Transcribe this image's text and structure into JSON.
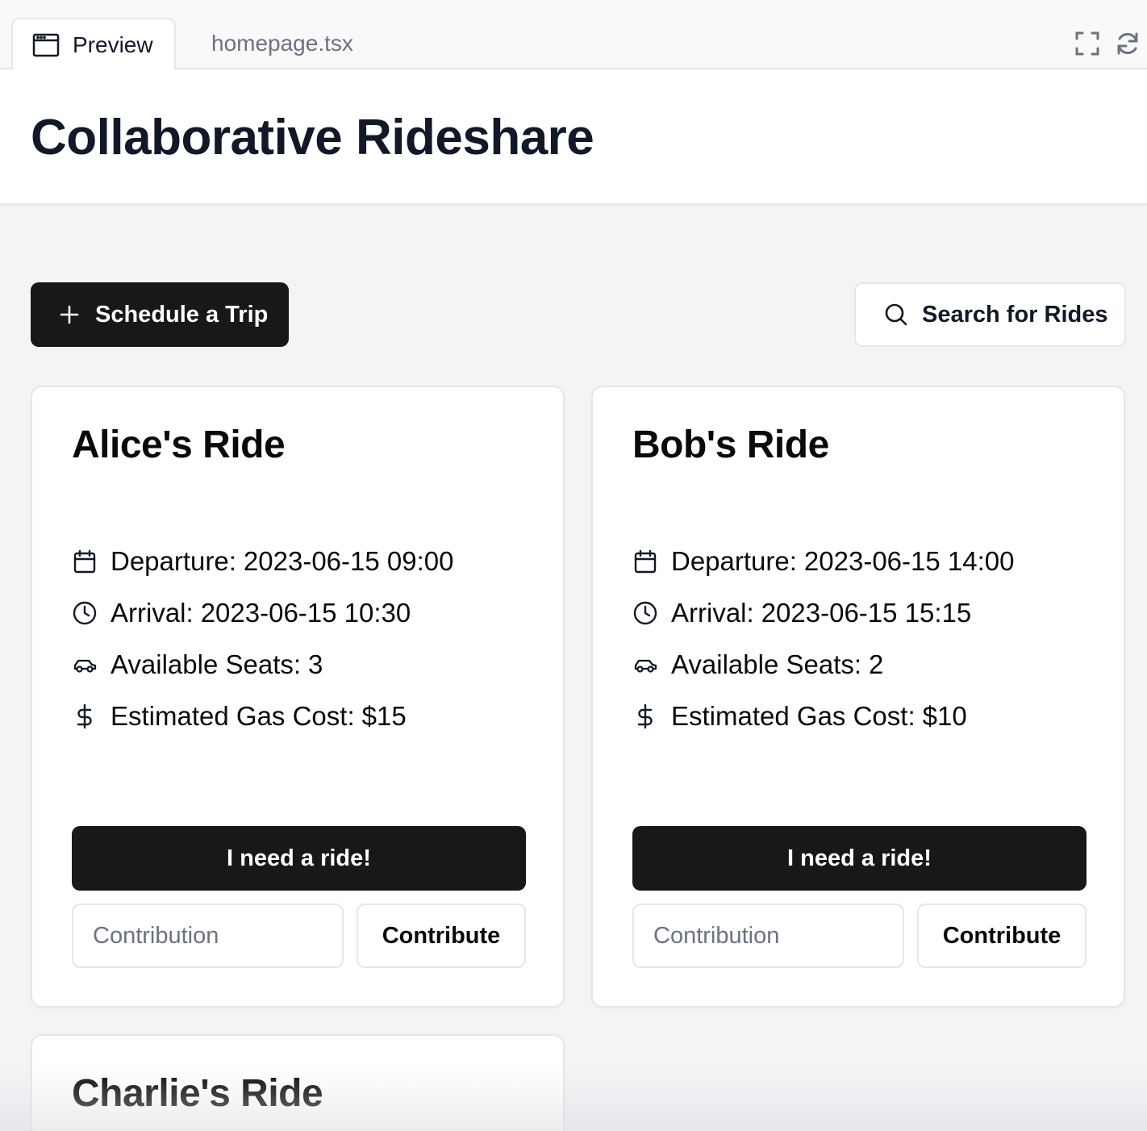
{
  "tabs": {
    "preview_label": "Preview",
    "file_label": "homepage.tsx",
    "icons": [
      "window-icon",
      "fullscreen-icon",
      "refresh-icon"
    ]
  },
  "app": {
    "title": "Collaborative Rideshare"
  },
  "actions": {
    "schedule_label": "Schedule a Trip",
    "search_label": "Search for Rides",
    "schedule_icon": "plus-icon",
    "search_icon": "search-icon"
  },
  "labels": {
    "departure": "Departure:",
    "arrival": "Arrival:",
    "seats": "Available Seats:",
    "gas": "Estimated Gas Cost:",
    "need_ride": "I need a ride!",
    "contribution_placeholder": "Contribution",
    "contribute": "Contribute"
  },
  "rides": [
    {
      "title": "Alice's Ride",
      "departure": "2023-06-15 09:00",
      "arrival": "2023-06-15 10:30",
      "seats": "3",
      "gas_cost": "$15"
    },
    {
      "title": "Bob's Ride",
      "departure": "2023-06-15 14:00",
      "arrival": "2023-06-15 15:15",
      "seats": "2",
      "gas_cost": "$10"
    },
    {
      "title": "Charlie's Ride"
    }
  ],
  "colors": {
    "primary_button": "#18181b",
    "background": "#f3f4f6",
    "border": "#e5e7eb",
    "text": "#111827",
    "muted_text": "#6b7280"
  }
}
